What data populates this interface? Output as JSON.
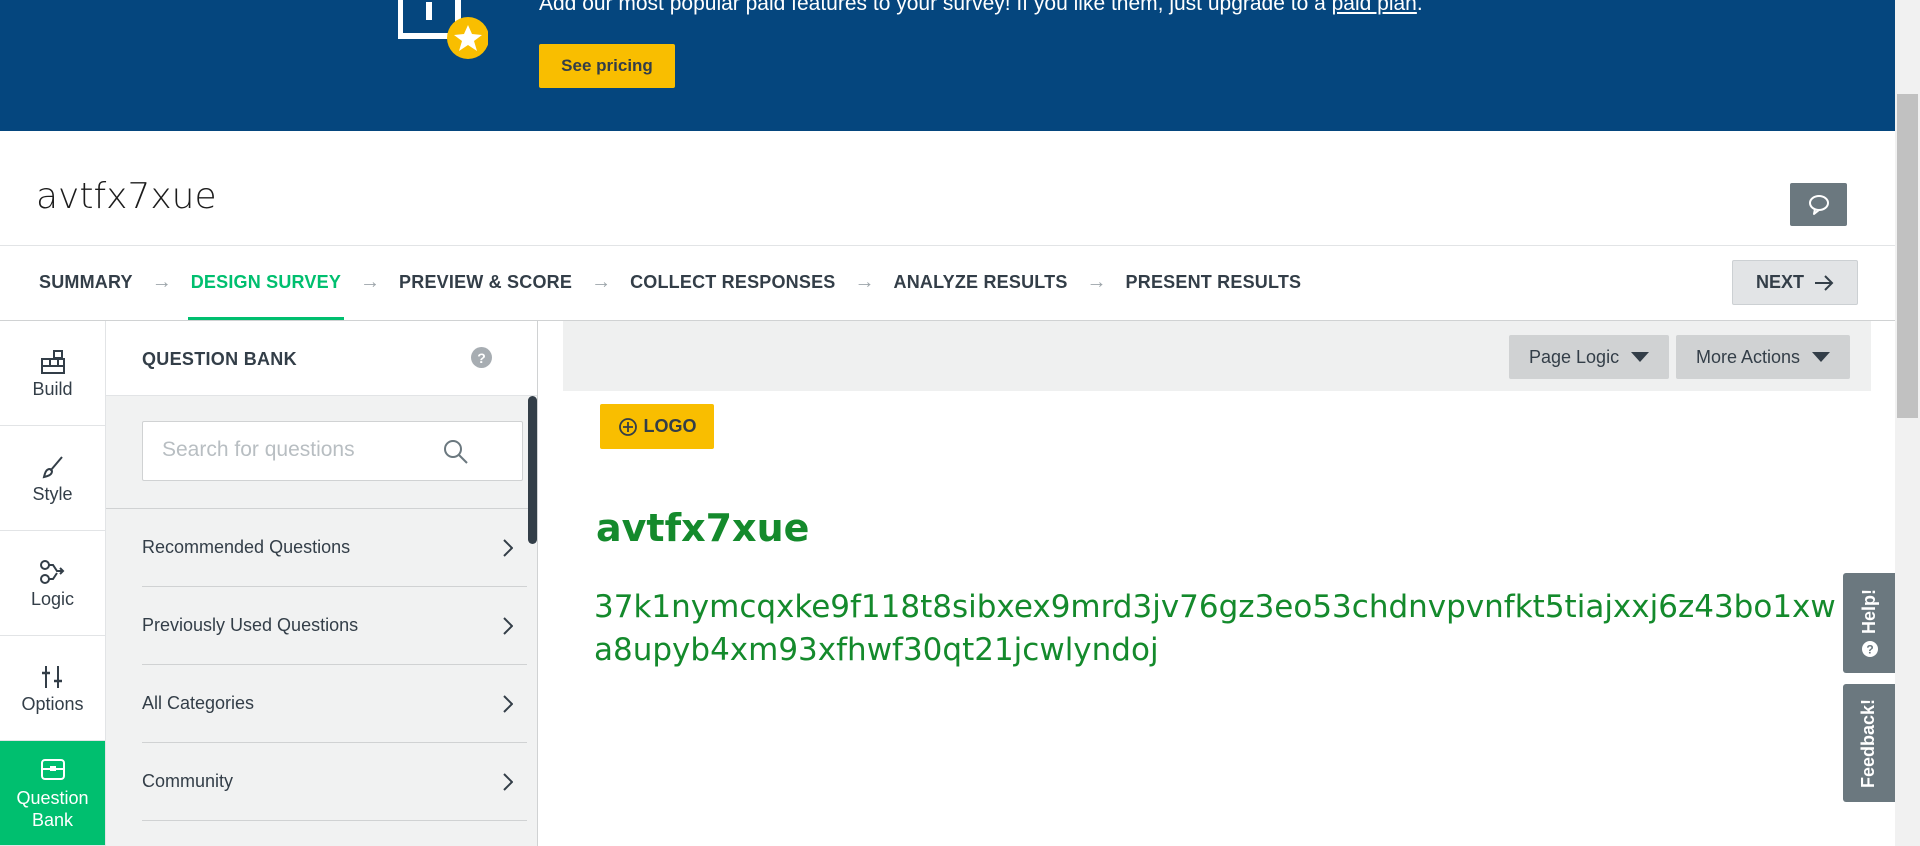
{
  "banner": {
    "text_prefix": "Add our most popular paid features to your survey! If you like them, just upgrade to a ",
    "link_text": "paid plan",
    "text_suffix": ".",
    "see_pricing_label": "See pricing"
  },
  "survey": {
    "title": "avtfx7xue"
  },
  "nav": {
    "steps": [
      {
        "label": "SUMMARY"
      },
      {
        "label": "DESIGN SURVEY"
      },
      {
        "label": "PREVIEW & SCORE"
      },
      {
        "label": "COLLECT RESPONSES"
      },
      {
        "label": "ANALYZE RESULTS"
      },
      {
        "label": "PRESENT RESULTS"
      }
    ],
    "active_step": "DESIGN SURVEY",
    "next_label": "NEXT"
  },
  "rail": {
    "items": [
      {
        "label": "Build",
        "icon": "build-icon"
      },
      {
        "label": "Style",
        "icon": "brush-icon"
      },
      {
        "label": "Logic",
        "icon": "logic-icon"
      },
      {
        "label": "Options",
        "icon": "sliders-icon"
      },
      {
        "label": "Question Bank",
        "icon": "question-bank-icon"
      }
    ],
    "active_item": "Question Bank"
  },
  "question_bank": {
    "title": "QUESTION BANK",
    "help_glyph": "?",
    "search_placeholder": "Search for questions",
    "items": [
      {
        "label": "Recommended Questions"
      },
      {
        "label": "Previously Used Questions"
      },
      {
        "label": "All Categories"
      },
      {
        "label": "Community"
      }
    ]
  },
  "toolbar": {
    "page_logic_label": "Page Logic",
    "more_actions_label": "More Actions"
  },
  "page": {
    "logo_label": "LOGO",
    "title": "avtfx7xue",
    "description": "37k1nymcqxke9f118t8sibxex9mrd3jv76gz3eo53chdnvpvnfkt5tiajxxj6z43bo1xwa8upyb4xm93xfhwf30qt21jcwlyndoj"
  },
  "side_tabs": {
    "help_label": "Help!",
    "feedback_label": "Feedback!"
  },
  "colors": {
    "banner_bg": "#05467e",
    "accent_yellow": "#f9be00",
    "brand_green": "#00bf6f",
    "title_green": "#148a2c",
    "side_tab_gray": "#6b787f"
  }
}
